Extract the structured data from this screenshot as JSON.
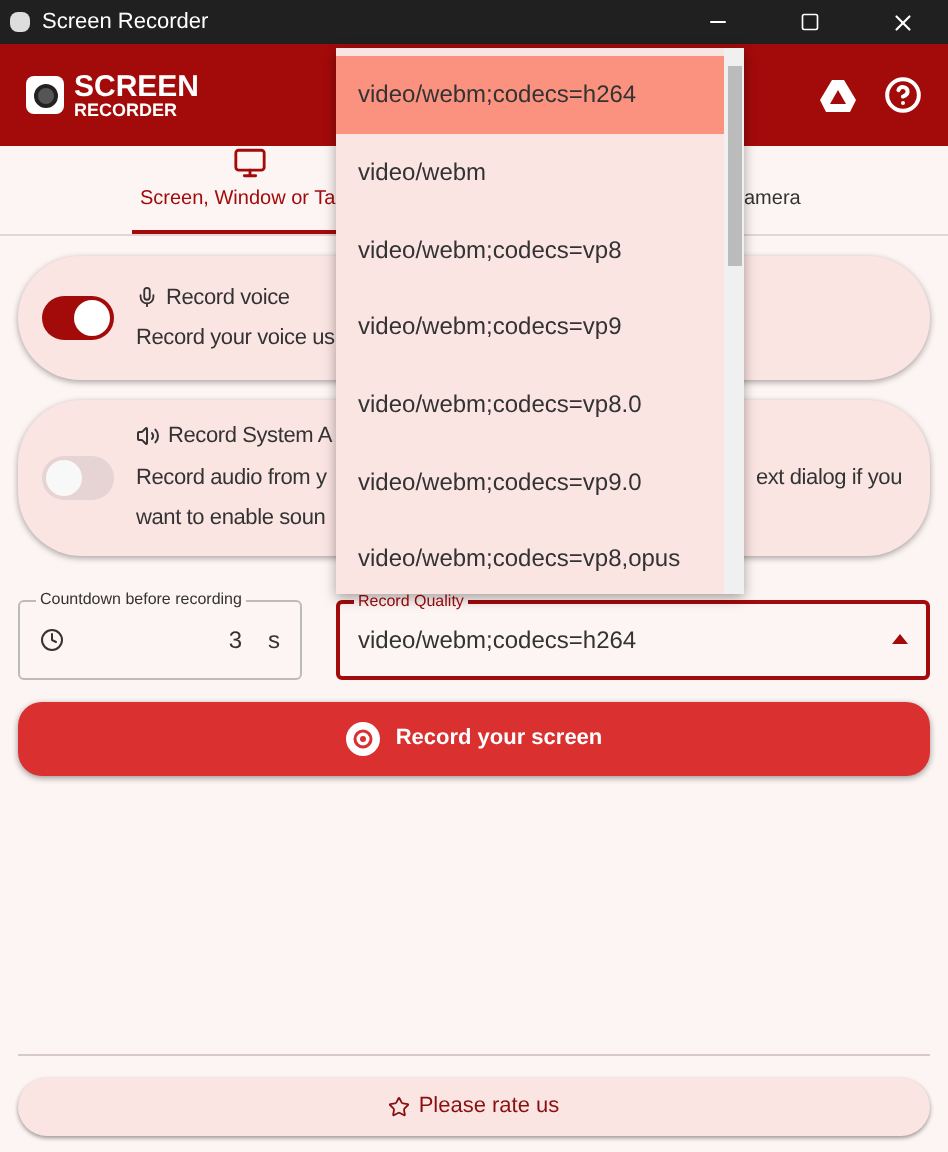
{
  "window": {
    "title": "Screen Recorder"
  },
  "header": {
    "logo_line_1": "SCREEN",
    "logo_line_2": "RECORDER"
  },
  "tabs": [
    {
      "label": "Screen, Window or Ta",
      "selected": true
    },
    {
      "label": "amera",
      "selected": false
    }
  ],
  "options": [
    {
      "title": "Record voice",
      "description": "Record your voice us",
      "on": true,
      "disabled": false,
      "kind": "mic"
    },
    {
      "title": "Record System A",
      "description": "Record audio from y",
      "description_right": "ext dialog if you",
      "description_2": "want to enable soun",
      "on": false,
      "disabled": true,
      "kind": "speaker"
    }
  ],
  "countdown": {
    "label": "Countdown before recording",
    "value": "3",
    "unit": "s"
  },
  "quality": {
    "label": "Record Quality",
    "value": "video/webm;codecs=h264",
    "expanded": true
  },
  "dropdown": [
    {
      "label": "video/webm;codecs=h264",
      "selected": true
    },
    {
      "label": "video/webm",
      "selected": false
    },
    {
      "label": "video/webm;codecs=vp8",
      "selected": false
    },
    {
      "label": "video/webm;codecs=vp9",
      "selected": false
    },
    {
      "label": "video/webm;codecs=vp8.0",
      "selected": false
    },
    {
      "label": "video/webm;codecs=vp9.0",
      "selected": false
    },
    {
      "label": "video/webm;codecs=vp8,opus",
      "selected": false
    }
  ],
  "record_button": "Record your screen",
  "rate_button": "Please rate us"
}
